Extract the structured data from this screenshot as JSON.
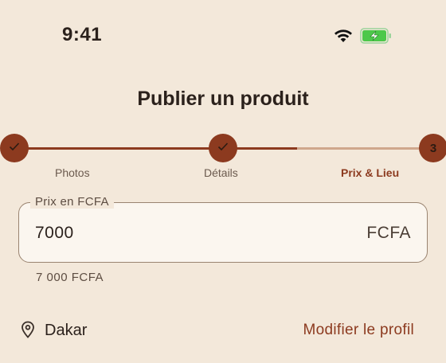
{
  "status_bar": {
    "time": "9:41",
    "wifi_icon": "wifi-icon",
    "battery_icon": "battery-charging-icon",
    "battery_color": "#4cc84a"
  },
  "header": {
    "title": "Publier un produit"
  },
  "stepper": {
    "accent_color": "#8c3a1f",
    "steps": [
      {
        "label": "Photos",
        "state": "completed",
        "icon": "check-icon"
      },
      {
        "label": "Détails",
        "state": "completed",
        "icon": "check-icon"
      },
      {
        "label": "Prix & Lieu",
        "state": "active",
        "number": "3"
      }
    ]
  },
  "price_field": {
    "label": "Prix en FCFA",
    "value": "7000",
    "suffix": "FCFA",
    "helper": "7 000 FCFA"
  },
  "location": {
    "icon": "location-pin-icon",
    "city": "Dakar",
    "edit_label": "Modifier le profil"
  }
}
